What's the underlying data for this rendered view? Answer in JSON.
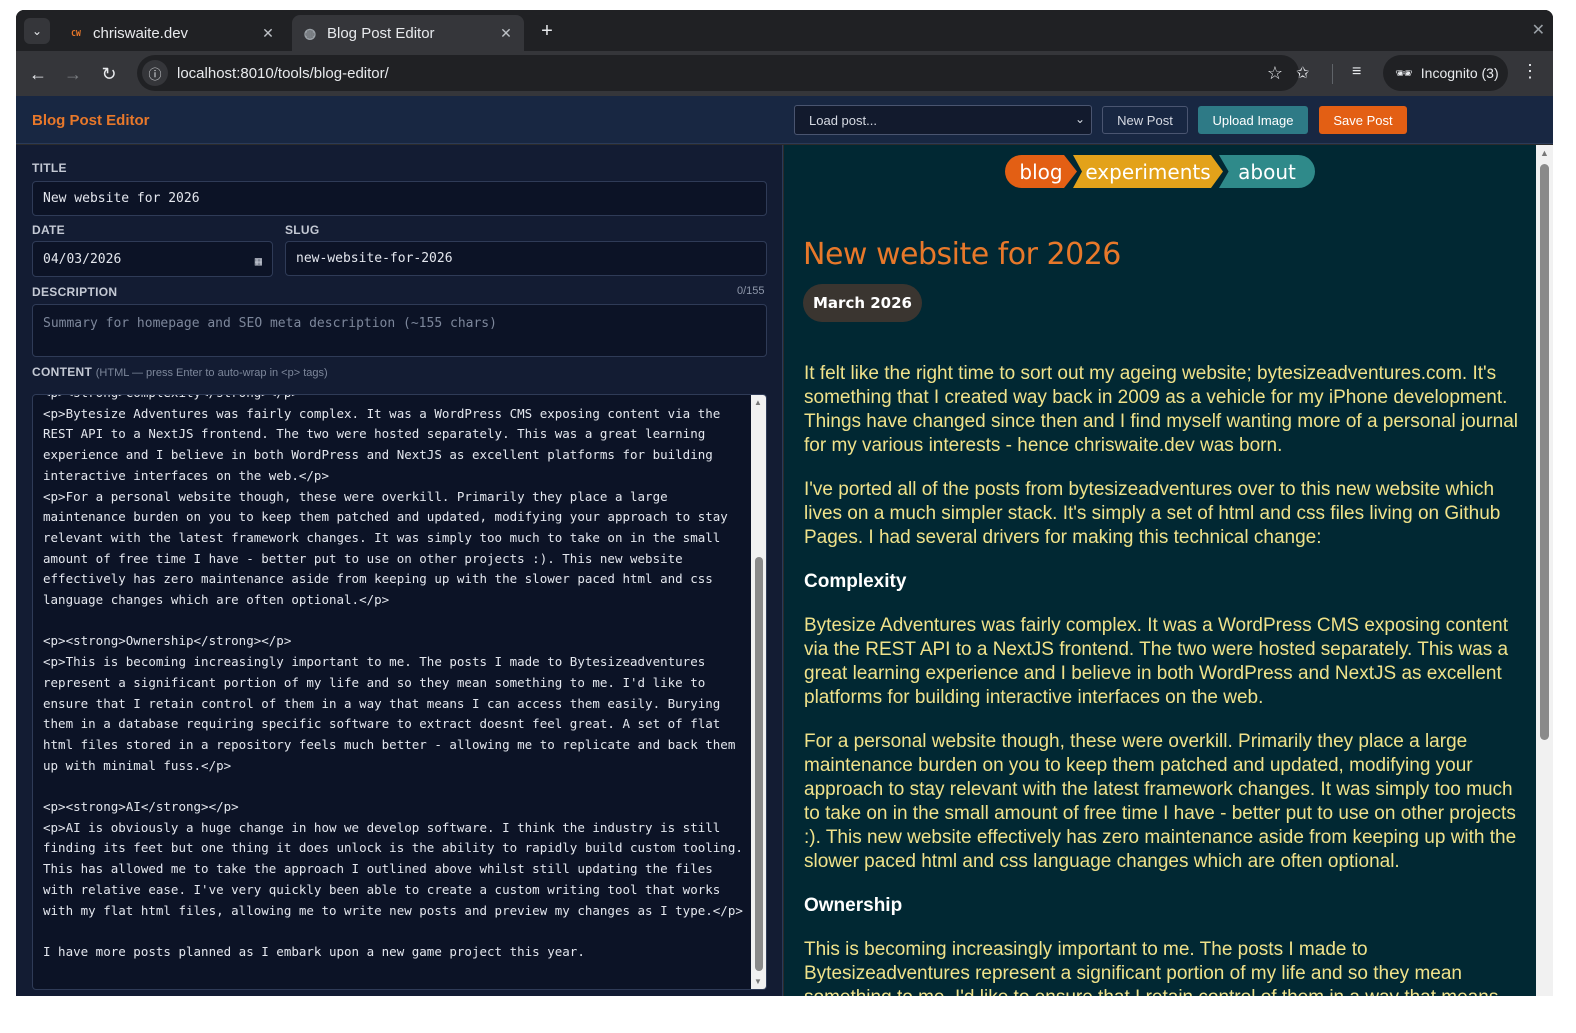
{
  "browser": {
    "tabs": [
      {
        "title": "chriswaite.dev",
        "favicon": "CW",
        "active": false
      },
      {
        "title": "Blog Post Editor",
        "favicon": "globe-icon",
        "active": true
      }
    ],
    "url": "localhost:8010/tools/blog-editor/",
    "incognito_label": "Incognito (3)"
  },
  "app": {
    "title": "Blog Post Editor",
    "load_select": "Load post...",
    "new_post": "New Post",
    "upload_image": "Upload Image",
    "save_post": "Save Post",
    "colors": {
      "accent_orange": "#e35f14",
      "accent_teal": "#2e7a86",
      "header_bg": "#182742"
    }
  },
  "editor": {
    "title_label": "TITLE",
    "title_value": "New website for 2026",
    "date_label": "DATE",
    "date_value": "04/03/2026",
    "slug_label": "SLUG",
    "slug_value": "new-website-for-2026",
    "description_label": "DESCRIPTION",
    "description_count": "0/155",
    "description_placeholder": "Summary for homepage and SEO meta description (~155 chars)",
    "content_label": "CONTENT",
    "content_hint": "(HTML — press Enter to auto-wrap in <p> tags)",
    "content_value": "<p><strong>Complexity</strong></p>\n<p>Bytesize Adventures was fairly complex. It was a WordPress CMS exposing content via the REST API to a NextJS frontend. The two were hosted separately. This was a great learning experience and I believe in both WordPress and NextJS as excellent platforms for building interactive interfaces on the web.</p>\n<p>For a personal website though, these were overkill. Primarily they place a large maintenance burden on you to keep them patched and updated, modifying your approach to stay relevant with the latest framework changes. It was simply too much to take on in the small amount of free time I have - better put to use on other projects :). This new website effectively has zero maintenance aside from keeping up with the slower paced html and css language changes which are often optional.</p>\n\n<p><strong>Ownership</strong></p>\n<p>This is becoming increasingly important to me. The posts I made to Bytesizeadventures represent a significant portion of my life and so they mean something to me. I'd like to ensure that I retain control of them in a way that means I can access them easily. Burying them in a database requiring specific software to extract doesnt feel great. A set of flat html files stored in a repository feels much better - allowing me to replicate and back them up with minimal fuss.</p>\n\n<p><strong>AI</strong></p>\n<p>AI is obviously a huge change in how we develop software. I think the industry is still finding its feet but one thing it does unlock is the ability to rapidly build custom tooling. This has allowed me to take the approach I outlined above whilst still updating the files with relative ease. I've very quickly been able to create a custom writing tool that works with my flat html files, allowing me to write new posts and preview my changes as I type.</p>\n\nI have more posts planned as I embark upon a new game project this year."
  },
  "preview": {
    "nav": [
      "blog",
      "experiments",
      "about"
    ],
    "post_title": "New website for 2026",
    "post_date": "March 2026",
    "p1": "It felt like the right time to sort out my ageing website; bytesizeadventures.com. It's something that I created way back in 2009 as a vehicle for my iPhone development. Things have changed since then and I find myself wanting more of a personal journal for my various interests - hence chriswaite.dev was born.",
    "p2": "I've ported all of the posts from bytesizeadventures over to this new website which lives on a much simpler stack. It's simply a set of html and css files living on Github Pages. I had several drivers for making this technical change:",
    "h_complexity": "Complexity",
    "p3": "Bytesize Adventures was fairly complex. It was a WordPress CMS exposing content via the REST API to a NextJS frontend. The two were hosted separately. This was a great learning experience and I believe in both WordPress and NextJS as excellent platforms for building interactive interfaces on the web.",
    "p4": "For a personal website though, these were overkill. Primarily they place a large maintenance burden on you to keep them patched and updated, modifying your approach to stay relevant with the latest framework changes. It was simply too much to take on in the small amount of free time I have - better put to use on other projects :). This new website effectively has zero maintenance aside from keeping up with the slower paced html and css language changes which are often optional.",
    "h_ownership": "Ownership",
    "p5": "This is becoming increasingly important to me. The posts I made to Bytesizeadventures represent a significant portion of my life and so they mean something to me. I'd like to ensure that I retain control of them in a way that means"
  }
}
